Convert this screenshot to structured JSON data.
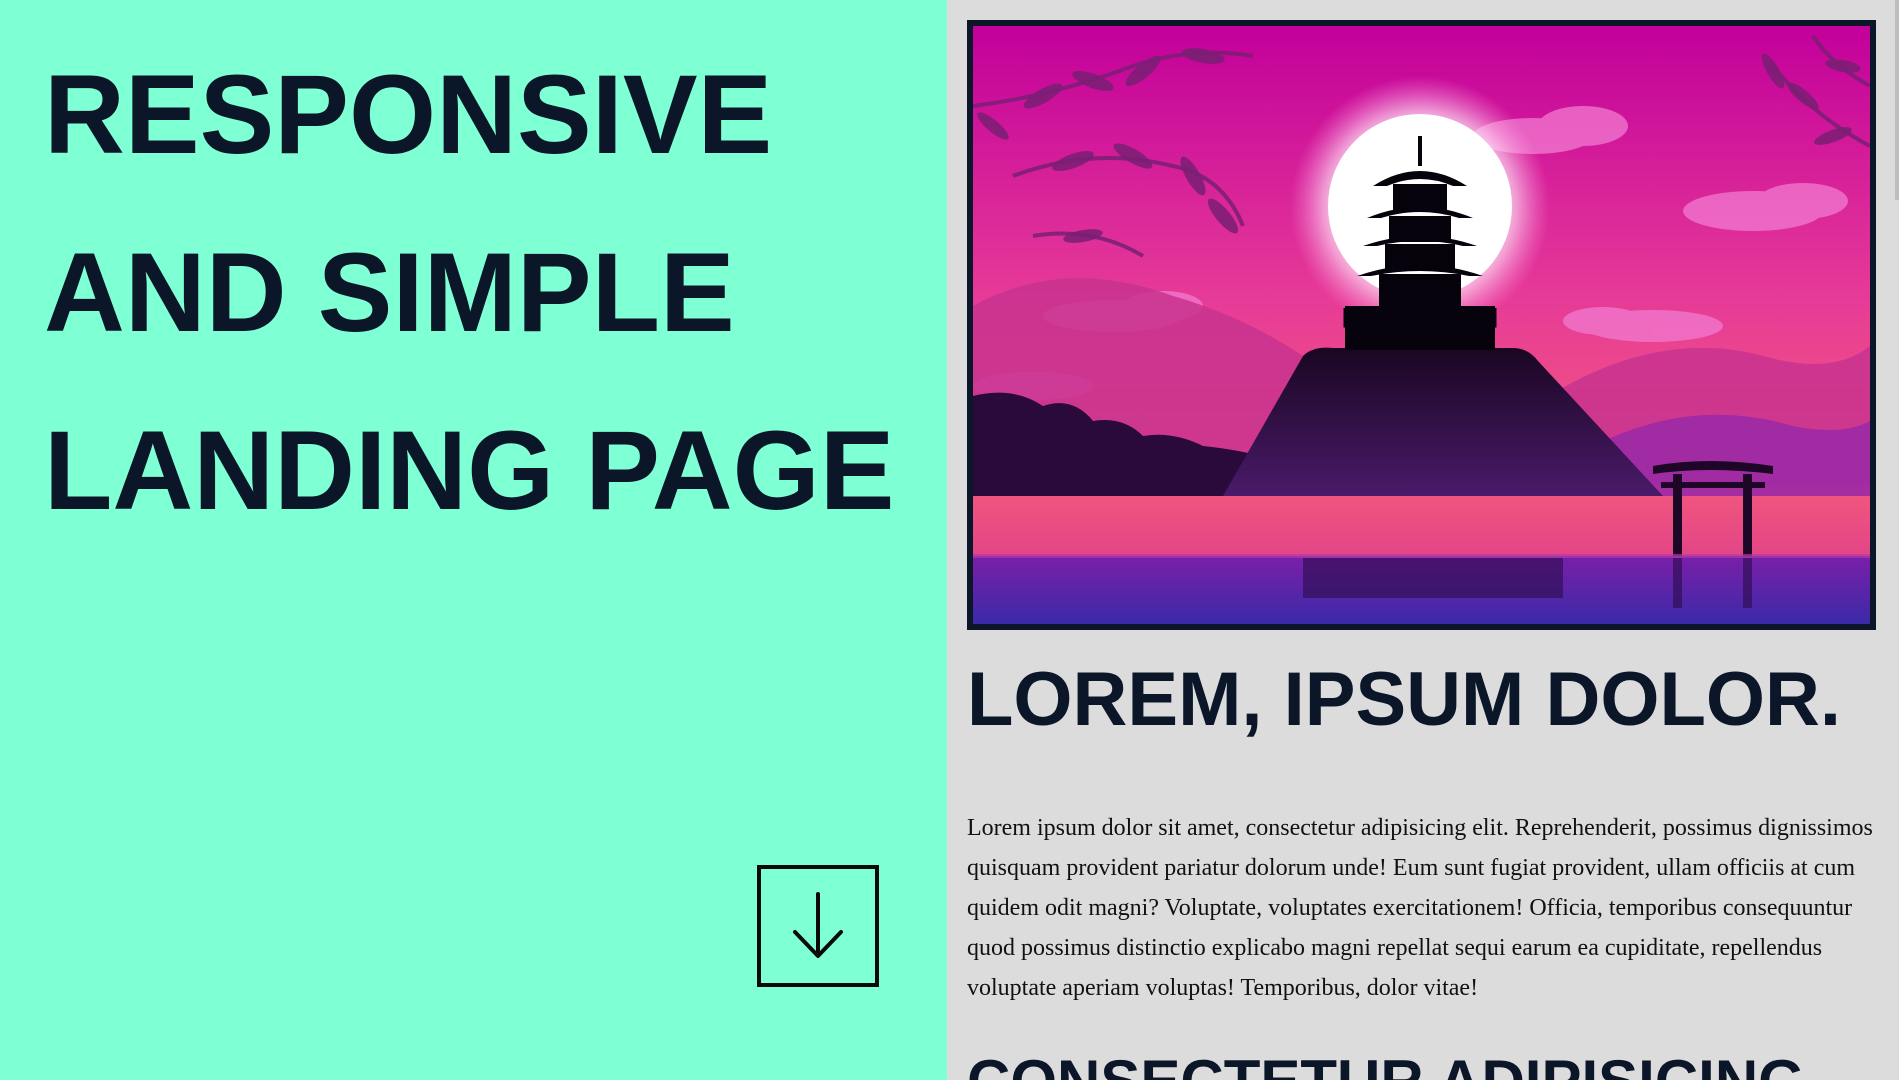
{
  "hero": {
    "title": "RESPONSIVE AND SIMPLE LANDING PAGE",
    "scroll_icon": "arrow-down-icon"
  },
  "content": {
    "image_alt": "pagoda-sunset-illustration",
    "heading": "LOREM, IPSUM DOLOR.",
    "paragraph": "Lorem ipsum dolor sit amet, consectetur adipisicing elit. Reprehenderit, possimus dignissimos quisquam provident pariatur dolorum unde! Eum sunt fugiat provident, ullam officiis at cum quidem odit magni? Voluptate, voluptates exercitationem! Officia, temporibus consequuntur quod possimus distinctio explicabo magni repellat sequi earum ea cupiditate, repellendus voluptate aperiam voluptas! Temporibus, dolor vitae!",
    "heading_2": "CONSECTETUR ADIPISICING"
  },
  "colors": {
    "left_bg": "#7fffd4",
    "right_bg": "#dcdcdc",
    "dark_text": "#0b1629"
  }
}
